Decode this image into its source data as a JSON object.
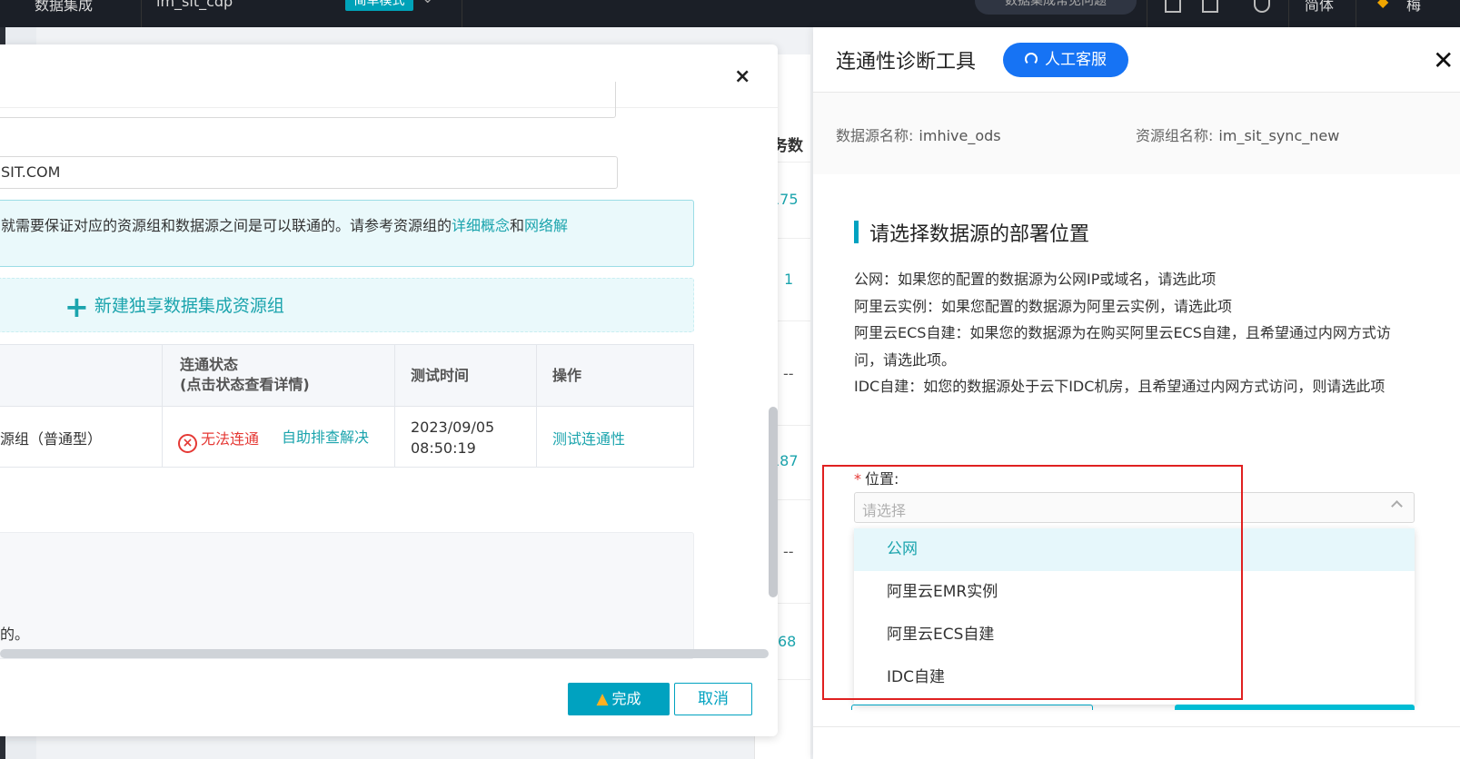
{
  "topbar": {
    "product": "数据集成",
    "workspace": "im_sit_cdp",
    "mode": "简单模式",
    "help": "数据集成常见问题",
    "lang": "简体",
    "user": "梅"
  },
  "background": {
    "column_header": "务数",
    "values": [
      "175",
      "1",
      "--",
      "187",
      "--",
      "68"
    ]
  },
  "modal": {
    "realm_value": "SIT.COM",
    "info_text_pre": "就需要保证对应的资源组和数据源之间是可以联通的。请参考资源组的",
    "info_link1": "详细概念",
    "info_and": "和",
    "info_link2": "网络解",
    "new_rg_label": "新建独享数据集成资源组",
    "table": {
      "headers": {
        "status_line1": "连通状态",
        "status_line2": "(点击状态查看详情)",
        "time": "测试时间",
        "action": "操作"
      },
      "row": {
        "group": "源组（普通型）",
        "status": "无法连通",
        "self_help": "自助排查解决",
        "date": "2023/09/05",
        "time": "08:50:19",
        "action": "测试连通性"
      }
    },
    "gray_text": "的。",
    "done_label": "完成",
    "cancel_label": "取消",
    "close_icon": "×"
  },
  "panel": {
    "title": "连通性诊断工具",
    "cs_label": "人工客服",
    "close_icon": "✕",
    "ds_label": "数据源名称:",
    "ds_value": "imhive_ods",
    "rg_label": "资源组名称:",
    "rg_value": "im_sit_sync_new",
    "section_title": "请选择数据源的部署位置",
    "desc": [
      "公网：如果您的配置的数据源为公网IP或域名，请选此项",
      "阿里云实例：如果您配置的数据源为阿里云实例，请选此项",
      "阿里云ECS自建：如果您的数据源为在购买阿里云ECS自建，且希望通过内网方式访问，请选此项。",
      "IDC自建：如您的数据源处于云下IDC机房，且希望通过内网方式访问，则请选此项"
    ],
    "location_label": "位置:",
    "location_required": "*",
    "select_placeholder": "请选择",
    "options": [
      "公网",
      "阿里云EMR实例",
      "阿里云ECS自建",
      "IDC自建"
    ]
  },
  "colors": {
    "accent": "#00a2c0",
    "link": "#1ba4ad",
    "error": "#e53935",
    "cs_button": "#1673f4",
    "highlight_box": "#e02020"
  }
}
